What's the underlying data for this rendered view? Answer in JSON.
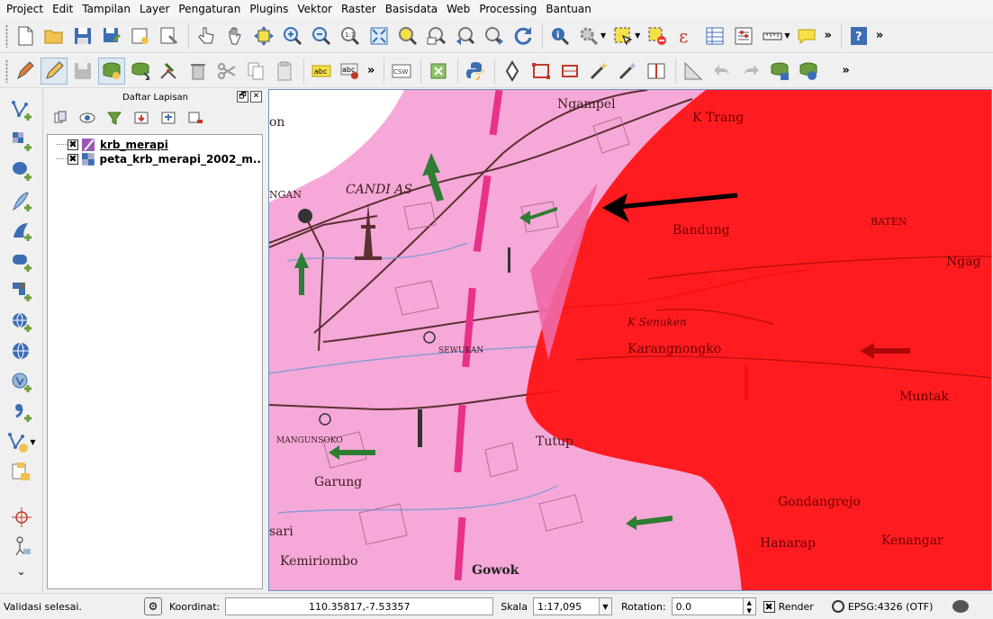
{
  "menu": [
    "Project",
    "Edit",
    "Tampilan",
    "Layer",
    "Pengaturan",
    "Plugins",
    "Vektor",
    "Raster",
    "Basisdata",
    "Web",
    "Processing",
    "Bantuan"
  ],
  "toolbar": {
    "overflow_label": "»",
    "text_label_abc": "abc",
    "csw_label": "CSW"
  },
  "layers_panel": {
    "title": "Daftar Lapisan",
    "float_label": "🗗",
    "close_label": "✕",
    "layers": [
      {
        "name": "krb_merapi",
        "checked": true
      },
      {
        "name": "peta_krb_merapi_2002_m...",
        "checked": true
      }
    ]
  },
  "map": {
    "labels": [
      "Ngampel",
      "K Trang",
      "CANDI AS",
      "Bandung",
      "NGAN",
      "BATEN",
      "Ngag",
      "SEWUKAN",
      "K Senuken",
      "Karangnongko",
      "Muntak",
      "MANGUNSOKO",
      "Tutup",
      "Garung",
      "Gondangrejo",
      "Hanarap",
      "Kenangar",
      "Kemiriombo",
      "Gowok",
      "sari",
      "on"
    ]
  },
  "status": {
    "message": "Validasi selesai.",
    "coord_label": "Koordinat:",
    "coord_value": "110.35817,-7.53357",
    "scale_label": "Skala",
    "scale_value": "1:17,095",
    "rotation_label": "Rotation:",
    "rotation_value": "0.0",
    "render_label": "Render",
    "crs_label": "EPSG:4326 (OTF)"
  }
}
